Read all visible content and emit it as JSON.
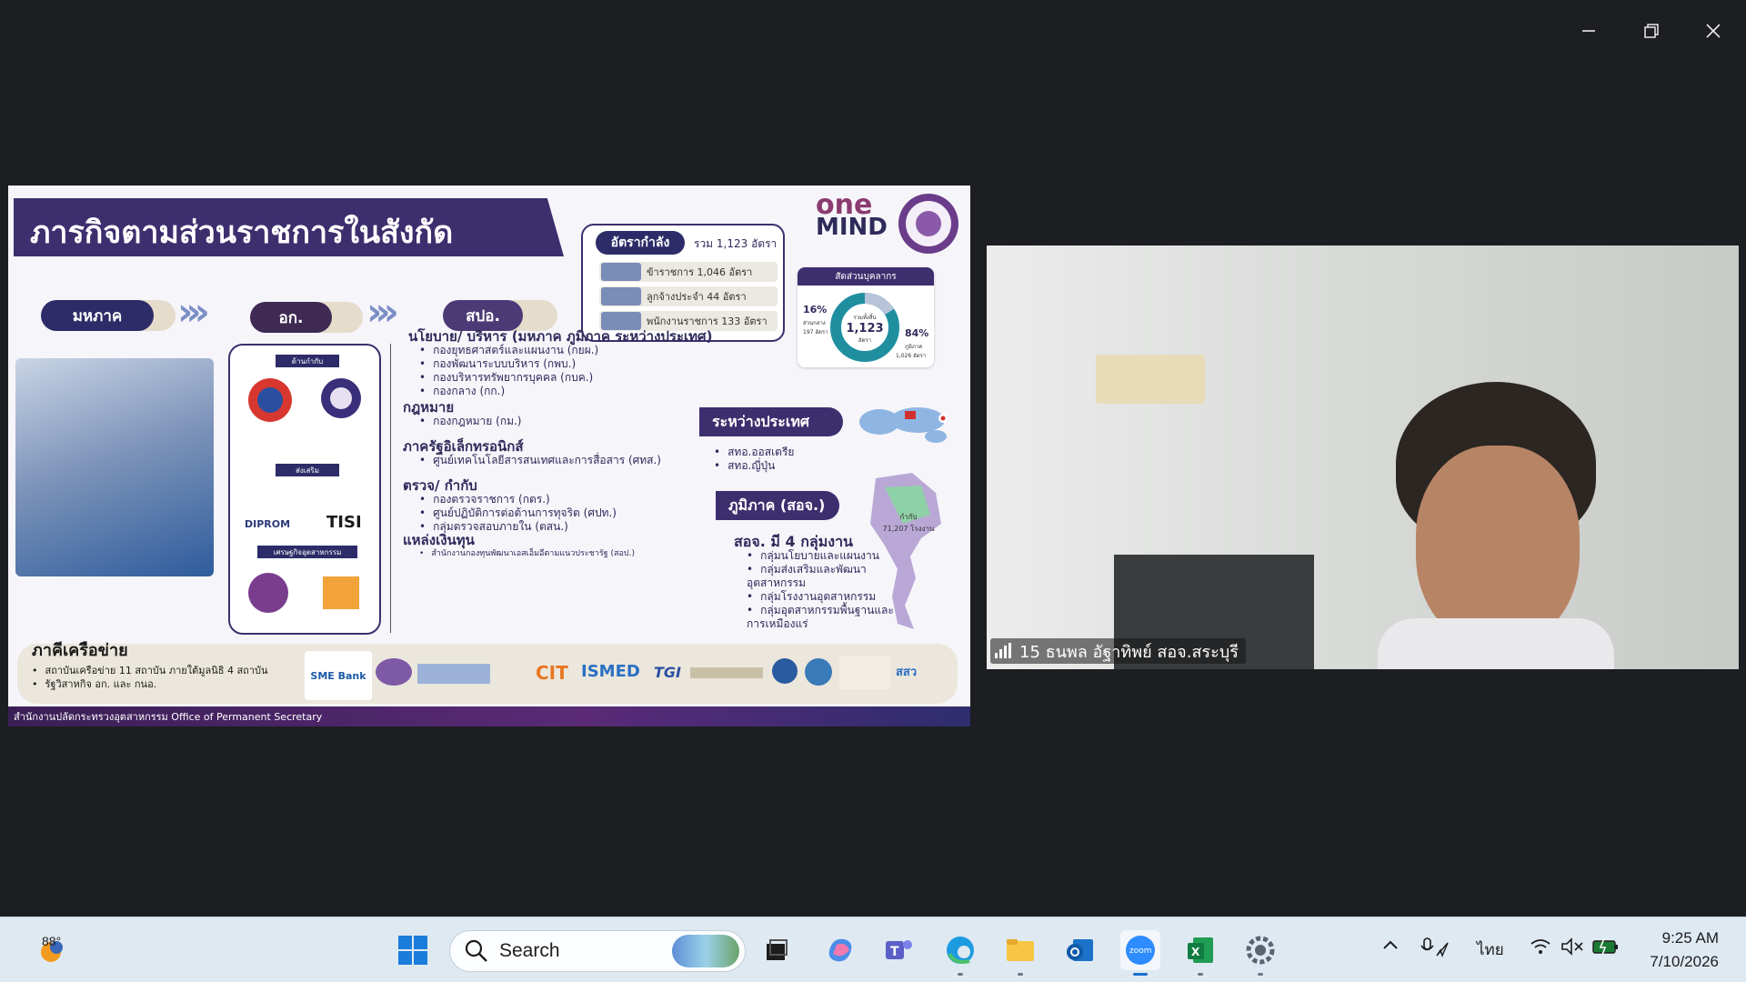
{
  "window": {
    "minimize_icon": "minimize-icon",
    "restore_icon": "restore-icon",
    "close_icon": "close-icon"
  },
  "slide": {
    "title": "ภารกิจตามส่วนราชการในสังกัด",
    "flow": [
      "มหภาค",
      "อก.",
      "สปอ."
    ],
    "logo_text": [
      "one",
      "MIND"
    ],
    "rate": {
      "header": "อัตรากำลัง",
      "total": "รวม 1,123 อัตรา",
      "rows": [
        "ข้าราชการ 1,046 อัตรา",
        "ลูกจ้างประจำ 44 อัตรา",
        "พนักงานราชการ 133 อัตรา"
      ]
    },
    "personnel": {
      "title": "สัดส่วนบุคลากร",
      "center_top": "รวมทั้งสิ้น",
      "center_value": "1,123",
      "center_unit": "อัตรา",
      "left_pct": "16%",
      "left_label": "ส่วนกลาง",
      "left_value": "197 อัตรา",
      "right_pct": "84%",
      "right_label": "ภูมิภาค",
      "right_value": "1,026 อัตรา",
      "share_central": 0.16,
      "share_region": 0.84
    },
    "agencies": {
      "side1": "ด้านกำกับ",
      "side2": "ส่งเสริม",
      "side3": "เศรษฐกิจอุตสาหกรรม",
      "dip": "DIPROM",
      "tisi": "TISI"
    },
    "sections": [
      {
        "title": "นโยบาย/ บริหาร (มหภาค ภูมิภาค ระหว่างประเทศ)",
        "items": [
          "กองยุทธศาสตร์และแผนงาน (กยผ.)",
          "กองพัฒนาระบบบริหาร (กพบ.)",
          "กองบริหารทรัพยากรบุคคล (กบค.)",
          "กองกลาง (กก.)"
        ]
      },
      {
        "title": "กฎหมาย",
        "items": [
          "กองกฎหมาย (กม.)"
        ]
      },
      {
        "title": "ภาครัฐอิเล็กทรอนิกส์",
        "items": [
          "ศูนย์เทคโนโลยีสารสนเทศและการสื่อสาร (ศทส.)"
        ]
      },
      {
        "title": "ตรวจ/ กำกับ",
        "items": [
          "กองตรวจราชการ (กตร.)",
          "ศูนย์ปฏิบัติการต่อต้านการทุจริต (ศปท.)",
          "กลุ่มตรวจสอบภายใน (ตสน.)"
        ]
      },
      {
        "title": "แหล่งเงินทุน",
        "items": [
          "สำนักงานกองทุนพัฒนาเอสเอ็มอีตามแนวประชารัฐ (สอป.)"
        ]
      }
    ],
    "international": {
      "title": "ระหว่างประเทศ",
      "items": [
        "สทอ.ออสเตรีย",
        "สทอ.ญี่ปุ่น"
      ]
    },
    "region": {
      "title": "ภูมิภาค (สอจ.)",
      "subtitle": "สอจ. มี 4 กลุ่มงาน",
      "items": [
        "กลุ่มนโยบายและแผนงาน",
        "กลุ่มส่งเสริมและพัฒนาอุตสาหกรรม",
        "กลุ่มโรงงานอุตสาหกรรม",
        "กลุ่มอุตสาหกรรมพื้นฐานและการเหมืองแร่"
      ],
      "factory_label": "กำกับ",
      "factory_count": "71,207 โรงงาน"
    },
    "network": {
      "title": "ภาคีเครือข่าย",
      "items": [
        "สถาบันเครือข่าย 11 สถาบัน ภายใต้มูลนิธิ 4 สถาบัน",
        "รัฐวิสาหกิจ อก. และ กนอ."
      ],
      "logos": [
        "SME Bank",
        "CIT",
        "ISMED",
        "TGI",
        "สสว"
      ]
    },
    "footer": "สำนักงานปลัดกระทรวงอุตสาหกรรม Office of Permanent Secretary"
  },
  "camera": {
    "participant_label": "15 ธนพล อัฐาทิพย์ สอจ.สระบุรี"
  },
  "taskbar": {
    "weather_temp": "88°",
    "search_placeholder": "Search",
    "language": "ไทย",
    "time": "9:25 AM",
    "date": "7/10/2026"
  }
}
